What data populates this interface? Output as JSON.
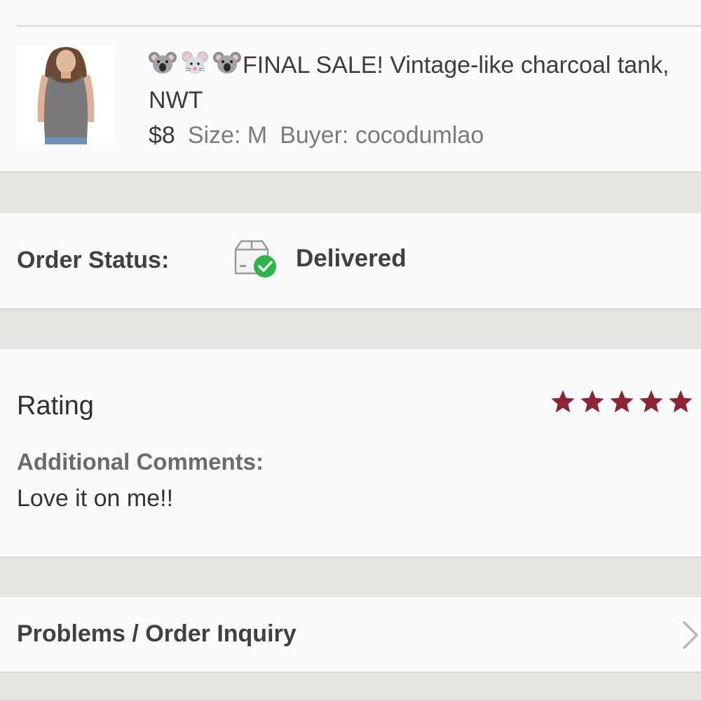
{
  "item": {
    "title": "FINAL SALE! Vintage-like charcoal tank, NWT",
    "title_emojis": [
      "koala-icon",
      "mouse-face-icon",
      "koala-icon"
    ],
    "price": "$8",
    "size": "Size: M",
    "buyer": "Buyer: cocodumlao"
  },
  "order_status": {
    "label": "Order Status:",
    "value": "Delivered",
    "icon": "package-delivered-icon",
    "check_color": "#2fb34a"
  },
  "rating": {
    "label": "Rating",
    "stars": 5,
    "max_stars": 5,
    "star_color": "#8b2535",
    "comments_label": "Additional Comments:",
    "comments_text": "Love it on me!!"
  },
  "problems": {
    "label": "Problems / Order Inquiry",
    "icon": "chevron-right-icon"
  }
}
